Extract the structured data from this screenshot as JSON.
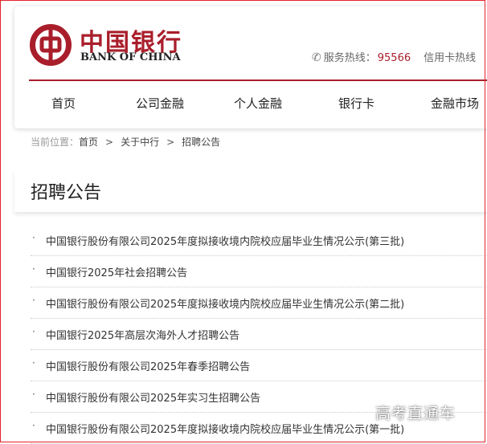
{
  "brand": {
    "name_cn": "中国银行",
    "name_en": "BANK OF CHINA",
    "color": "#a91e2b"
  },
  "header": {
    "hotline_label": "服务热线：",
    "hotline_number": "95566",
    "credit_text": "信用卡热线",
    "phone_icon": "phone-icon"
  },
  "nav": {
    "items": [
      {
        "label": "首页"
      },
      {
        "label": "公司金融"
      },
      {
        "label": "个人金融"
      },
      {
        "label": "银行卡"
      },
      {
        "label": "金融市场"
      }
    ]
  },
  "breadcrumb": {
    "prefix": "当前位置：",
    "items": [
      "首页",
      "关于中行",
      "招聘公告"
    ],
    "separator": ">"
  },
  "page": {
    "title": "招聘公告"
  },
  "announcements": [
    {
      "title": "中国银行股份有限公司2025年度拟接收境内院校应届毕业生情况公示(第三批)"
    },
    {
      "title": "中国银行2025年社会招聘公告"
    },
    {
      "title": "中国银行股份有限公司2025年度拟接收境内院校应届毕业生情况公示(第二批)"
    },
    {
      "title": "中国银行2025年高层次海外人才招聘公告"
    },
    {
      "title": "中国银行股份有限公司2025年春季招聘公告"
    },
    {
      "title": "中国银行股份有限公司2025年实习生招聘公告"
    },
    {
      "title": "中国银行股份有限公司2025年度拟接收境内院校应届毕业生情况公示(第一批)"
    }
  ],
  "bullet_char": "·",
  "watermark": "高考直通车"
}
